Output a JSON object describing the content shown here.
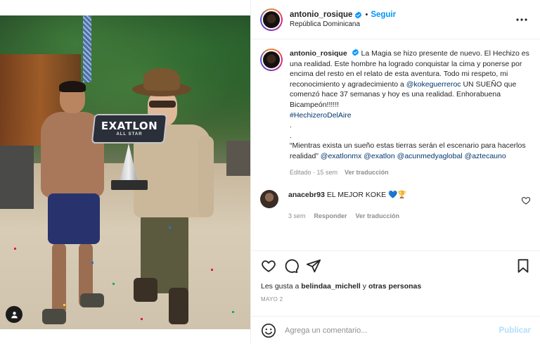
{
  "post": {
    "username": "antonio_rosique",
    "follow_label": "Seguir",
    "location": "República Dominicana",
    "dot": "•",
    "more_icon": "more-horizontal-icon",
    "image": {
      "trophy_title": "EXATLON",
      "trophy_subtitle": "ALL STAR"
    }
  },
  "caption": {
    "username": "antonio_rosique",
    "text_1": "La Magia se hizo presente de nuevo. El Hechizo es una realidad. Este hombre ha logrado conquistar la cima y ponerse por encima del resto en el relato de esta aventura. Todo mi respeto, mi reconocimiento y agradecimiento a",
    "mention_1": "@kokeguerreroc",
    "text_2": "UN SUEÑO que comenzó hace 37 semanas y hoy es una realidad. Enhorabuena Bicampeón!!!!!!",
    "hashtag": "#HechizeroDelAire",
    "sep1": ".",
    "sep2": ".",
    "quote": "“Mientras exista un sueño estas tierras serán el escenario para hacerlos realidad”",
    "mention_2": "@exatlonmx",
    "mention_3": "@exatlon",
    "mention_4": "@acunmedyaglobal",
    "mention_5": "@aztecauno",
    "edited": "Editado · 15 sem",
    "translate": "Ver traducción"
  },
  "comment": {
    "username": "anacebr93",
    "text": "EL MEJOR KOKE 💙🏆",
    "time": "3 sem",
    "reply": "Responder",
    "translate": "Ver traducción"
  },
  "likes": {
    "prefix": "Les gusta a",
    "user": "belindaa_michell",
    "connector": "y",
    "others": "otras personas"
  },
  "date": "MAYO 2",
  "add_comment": {
    "placeholder": "Agrega un comentario...",
    "post_label": "Publicar"
  },
  "colors": {
    "accent": "#0095f6",
    "link": "#00376b",
    "muted": "#8e8e8e",
    "post_disabled": "#b2dffc"
  }
}
